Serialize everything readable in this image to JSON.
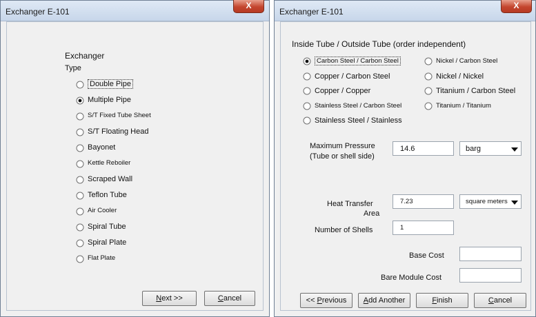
{
  "left_window": {
    "title": "Exchanger E-101",
    "close_label": "X",
    "heading": "Exchanger",
    "subheading": "Type",
    "types": [
      {
        "label": "Double Pipe",
        "selected": false
      },
      {
        "label": "Multiple Pipe",
        "selected": true
      },
      {
        "label": "S/T Fixed Tube Sheet",
        "selected": false
      },
      {
        "label": "S/T Floating Head",
        "selected": false
      },
      {
        "label": "Bayonet",
        "selected": false
      },
      {
        "label": "Kettle Reboiler",
        "selected": false
      },
      {
        "label": "Scraped Wall",
        "selected": false
      },
      {
        "label": "Teflon Tube",
        "selected": false
      },
      {
        "label": "Air Cooler",
        "selected": false
      },
      {
        "label": "Spiral Tube",
        "selected": false
      },
      {
        "label": "Spiral Plate",
        "selected": false
      },
      {
        "label": "Flat Plate",
        "selected": false
      }
    ],
    "next_mnemonic": "N",
    "next_rest": "ext >>",
    "cancel_mnemonic": "C",
    "cancel_rest": "ancel"
  },
  "right_window": {
    "title": "Exchanger E-101",
    "close_label": "X",
    "material_heading": "Inside Tube / Outside Tube (order independent)",
    "materials_left": [
      {
        "label": "Carbon Steel / Carbon Steel",
        "selected": true
      },
      {
        "label": "Copper / Carbon Steel",
        "selected": false
      },
      {
        "label": "Copper / Copper",
        "selected": false
      },
      {
        "label": "Stainless Steel / Carbon Steel",
        "selected": false
      },
      {
        "label": "Stainless Steel / Stainless",
        "selected": false
      }
    ],
    "materials_right": [
      {
        "label": "Nickel / Carbon Steel",
        "selected": false
      },
      {
        "label": "Nickel / Nickel",
        "selected": false
      },
      {
        "label": "Titanium / Carbon Steel",
        "selected": false
      },
      {
        "label": "Titanium / Titanium",
        "selected": false
      }
    ],
    "pressure_label_1": "Maximum Pressure",
    "pressure_label_2": "(Tube or shell side)",
    "pressure_value": "14.6",
    "pressure_unit": "barg",
    "area_label_1": "Heat Transfer",
    "area_label_2": "Area",
    "area_value": "7.23",
    "area_unit": "square meters",
    "shells_label": "Number of Shells",
    "shells_value": "1",
    "base_cost_label": "Base Cost",
    "base_cost_value": "",
    "bare_module_label": "Bare Module Cost",
    "bare_module_value": "",
    "prev_prefix": "<< ",
    "prev_mnemonic": "P",
    "prev_rest": "revious",
    "add_mnemonic": "A",
    "add_rest": "dd Another",
    "finish_mnemonic": "F",
    "finish_rest": "inish",
    "cancel_mnemonic": "C",
    "cancel_rest": "ancel"
  }
}
